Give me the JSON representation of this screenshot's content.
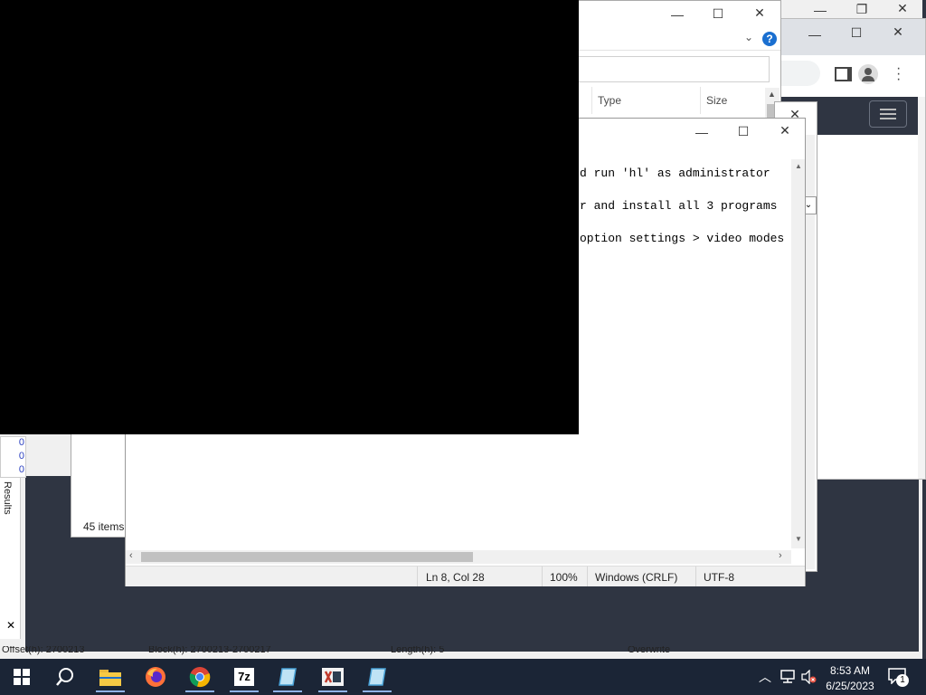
{
  "hex_editor": {
    "results_label": "Results",
    "close_glyph": "✕",
    "column_values": [
      "0",
      "0",
      "0"
    ],
    "status": {
      "offset": "Offset(h): 2700213",
      "block": "Block(h): 2700213-2700217",
      "length": "Length(h): 5",
      "mode": "Overwrite"
    }
  },
  "explorer": {
    "columns": {
      "type": "Type",
      "size": "Size"
    },
    "status_items": "45 items",
    "help_glyph": "?"
  },
  "notepad": {
    "lines": [
      "d run 'hl' as administrator",
      "r and install all 3 programs",
      "option settings > video modes"
    ],
    "status": {
      "position": "Ln 8, Col 28",
      "zoom": "100%",
      "line_ending": "Windows (CRLF)",
      "encoding": "UTF-8"
    }
  },
  "taskbar": {
    "time": "8:53 AM",
    "date": "6/25/2023",
    "notification_count": "1",
    "app_7zip_label": "7z"
  },
  "colors": {
    "taskbar": "#1b2536",
    "desktop_dark": "#2f3542",
    "accent_blue": "#0b6fd6"
  }
}
